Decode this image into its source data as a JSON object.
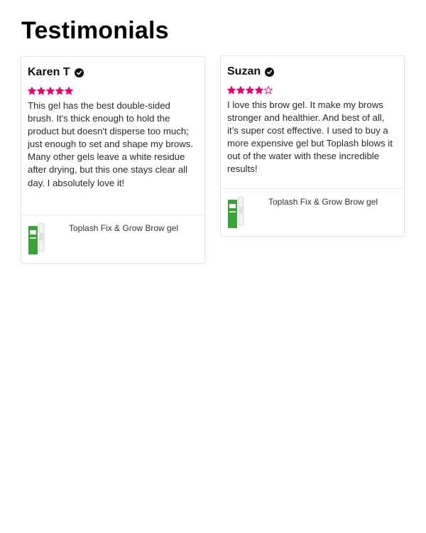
{
  "page": {
    "title": "Testimonials"
  },
  "colors": {
    "star": "#e8006f",
    "text": "#2a2a2a",
    "product_green": "#3aa43b"
  },
  "testimonials": [
    {
      "name": "Karen T",
      "verified_icon": "check-circle-icon",
      "rating": 5,
      "rating_max": 5,
      "text": "This gel has the best double-sided brush. It's thick enough to hold the product but doesn't disperse too much; just enough to set and shape my brows. Many other gels leave a white residue after drying, but this one stays clear all day. I absolutely love it!",
      "product": "Toplash Fix & Grow Brow gel"
    },
    {
      "name": "Suzan",
      "verified_icon": "check-circle-icon",
      "rating": 4,
      "rating_max": 5,
      "text": "I love this brow gel. It make my brows stronger and healthier. And best of all, it’s super cost effective. I used to buy a more expensive gel but Toplash blows it out of the water with these incredible results!",
      "product": "Toplash Fix & Grow Brow gel"
    }
  ]
}
